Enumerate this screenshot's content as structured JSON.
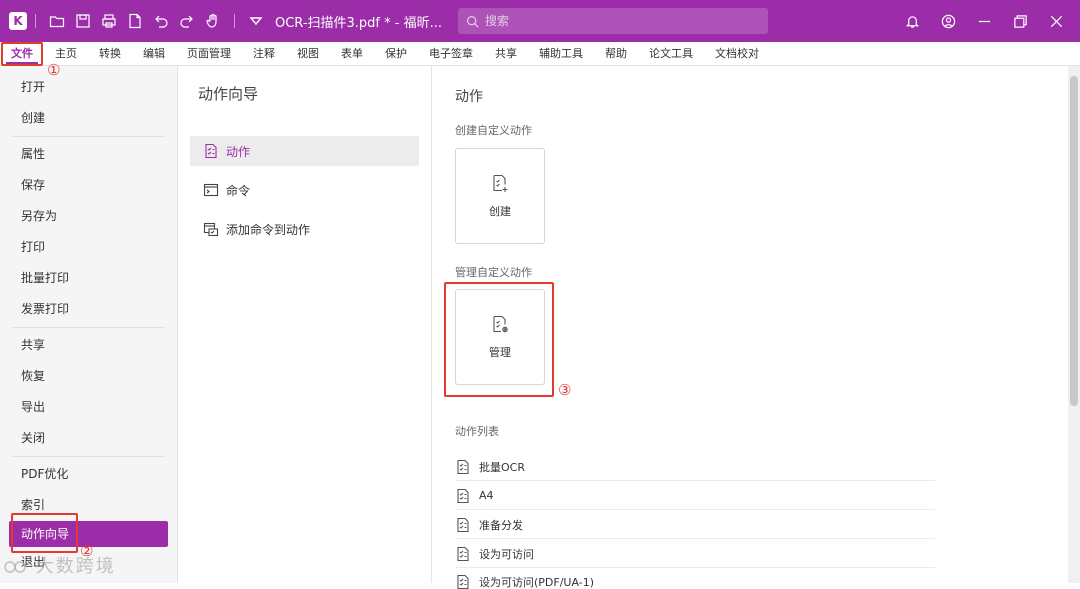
{
  "titlebar": {
    "app_icon": "foxit-logo-icon",
    "document_title": "OCR-扫描件3.pdf * - 福昕...",
    "search_placeholder": "搜索",
    "quick_access_icons": [
      "open-folder-icon",
      "save-icon",
      "print-icon",
      "new-document-icon",
      "undo-icon",
      "redo-icon",
      "hand-tool-icon"
    ]
  },
  "menu": {
    "tabs": [
      "文件",
      "主页",
      "转换",
      "编辑",
      "页面管理",
      "注释",
      "视图",
      "表单",
      "保护",
      "电子签章",
      "共享",
      "辅助工具",
      "帮助",
      "论文工具",
      "文档校对"
    ],
    "active_tab": "文件"
  },
  "sidebar": {
    "groups": [
      [
        "打开",
        "创建"
      ],
      [
        "属性",
        "保存",
        "另存为",
        "打印",
        "批量打印",
        "发票打印"
      ],
      [
        "共享",
        "恢复",
        "导出",
        "关闭"
      ],
      [
        "PDF优化",
        "索引",
        "动作向导",
        "退出"
      ]
    ],
    "active_item": "动作向导"
  },
  "middle": {
    "title": "动作向导",
    "items": [
      "动作",
      "命令",
      "添加命令到动作"
    ]
  },
  "content": {
    "title": "动作",
    "create_section_title": "创建自定义动作",
    "create_card_label": "创建",
    "manage_section_title": "管理自定义动作",
    "manage_card_label": "管理",
    "list_title": "动作列表",
    "list_items": [
      "批量OCR",
      "A4",
      "准备分发",
      "设为可访问",
      "设为可访问(PDF/UA-1)"
    ]
  },
  "annotations": {
    "step1": "①",
    "step2": "②",
    "step3": "③"
  },
  "watermark": "大数跨境",
  "colors": {
    "brand": "#9b2ea8",
    "annotation_red": "#e23a2e"
  }
}
